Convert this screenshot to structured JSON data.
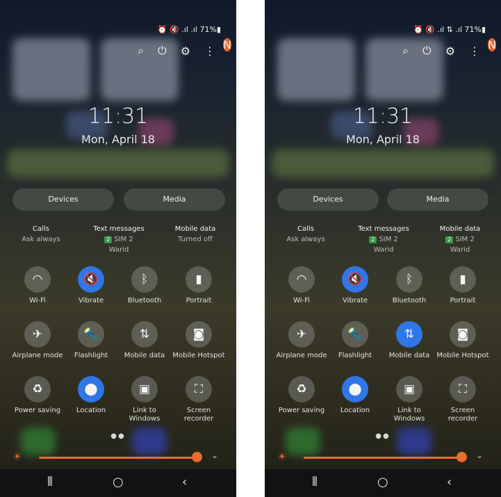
{
  "screens": [
    {
      "status": "⏰ 🔇 .ıl .ıl 71%▮",
      "clock": "11:31",
      "date": "Mon, April 18",
      "buttons": {
        "devices": "Devices",
        "media": "Media"
      },
      "sims": [
        {
          "title": "Calls",
          "line1": "Ask always",
          "line2": "",
          "badge": ""
        },
        {
          "title": "Text messages",
          "line1": "SIM 2",
          "line2": "Warid",
          "badge": "2"
        },
        {
          "title": "Mobile data",
          "line1": "Turned off",
          "line2": "",
          "badge": ""
        }
      ],
      "tiles": [
        {
          "label": "Wi-Fi",
          "icon": "wifi-icon",
          "active": false
        },
        {
          "label": "Vibrate",
          "icon": "vibrate-icon",
          "active": true
        },
        {
          "label": "Bluetooth",
          "icon": "bluetooth-icon",
          "active": false
        },
        {
          "label": "Portrait",
          "icon": "portrait-lock-icon",
          "active": false
        },
        {
          "label": "Airplane mode",
          "icon": "airplane-icon",
          "active": false
        },
        {
          "label": "Flashlight",
          "icon": "flashlight-icon",
          "active": false
        },
        {
          "label": "Mobile data",
          "icon": "mobile-data-icon",
          "active": false
        },
        {
          "label": "Mobile Hotspot",
          "icon": "hotspot-icon",
          "active": false
        },
        {
          "label": "Power saving",
          "icon": "power-saving-icon",
          "active": false
        },
        {
          "label": "Location",
          "icon": "location-icon",
          "active": true
        },
        {
          "label": "Link to Windows",
          "icon": "link-to-windows-icon",
          "active": false
        },
        {
          "label": "Screen recorder",
          "icon": "screen-recorder-icon",
          "active": false
        }
      ],
      "notification_badge": "N",
      "brightness": 0.95
    },
    {
      "status": "⏰ 🔇 .ıl ⇅ .ıl 71%▮",
      "clock": "11:31",
      "date": "Mon, April 18",
      "buttons": {
        "devices": "Devices",
        "media": "Media"
      },
      "sims": [
        {
          "title": "Calls",
          "line1": "Ask always",
          "line2": "",
          "badge": ""
        },
        {
          "title": "Text messages",
          "line1": "SIM 2",
          "line2": "Warid",
          "badge": "2"
        },
        {
          "title": "Mobile data",
          "line1": "SIM 2",
          "line2": "Warid",
          "badge": "2"
        }
      ],
      "tiles": [
        {
          "label": "Wi-Fi",
          "icon": "wifi-icon",
          "active": false
        },
        {
          "label": "Vibrate",
          "icon": "vibrate-icon",
          "active": true
        },
        {
          "label": "Bluetooth",
          "icon": "bluetooth-icon",
          "active": false
        },
        {
          "label": "Portrait",
          "icon": "portrait-lock-icon",
          "active": false
        },
        {
          "label": "Airplane mode",
          "icon": "airplane-icon",
          "active": false
        },
        {
          "label": "Flashlight",
          "icon": "flashlight-icon",
          "active": false
        },
        {
          "label": "Mobile data",
          "icon": "mobile-data-icon",
          "active": true
        },
        {
          "label": "Mobile Hotspot",
          "icon": "hotspot-icon",
          "active": false
        },
        {
          "label": "Power saving",
          "icon": "power-saving-icon",
          "active": false
        },
        {
          "label": "Location",
          "icon": "location-icon",
          "active": true
        },
        {
          "label": "Link to Windows",
          "icon": "link-to-windows-icon",
          "active": false
        },
        {
          "label": "Screen recorder",
          "icon": "screen-recorder-icon",
          "active": false
        }
      ],
      "notification_badge": "N",
      "brightness": 0.95
    }
  ],
  "colors": {
    "accent": "#ec6a2e",
    "active_tile": "#2f76e6",
    "sim_badge": "#3a9a48"
  }
}
